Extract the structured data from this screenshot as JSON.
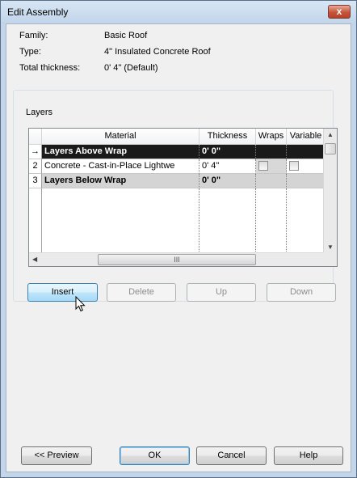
{
  "window": {
    "title": "Edit Assembly",
    "close_glyph": "x"
  },
  "properties": [
    {
      "label": "Family:",
      "value": "Basic Roof"
    },
    {
      "label": "Type:",
      "value": "4\" Insulated Concrete Roof"
    },
    {
      "label": "Total thickness:",
      "value": "0'  4\" (Default)"
    }
  ],
  "layers": {
    "group_title": "Layers",
    "columns": [
      "Material",
      "Thickness",
      "Wraps",
      "Variable"
    ],
    "rows": [
      {
        "num": "→",
        "material": "Layers Above Wrap",
        "thickness": "0'  0\"",
        "wraps": null,
        "variable": null,
        "style": "dark"
      },
      {
        "num": "2",
        "material": "Concrete - Cast-in-Place Lightwe",
        "thickness": "0'  4\"",
        "wraps": false,
        "variable": false,
        "style": "normal"
      },
      {
        "num": "3",
        "material": "Layers Below Wrap",
        "thickness": "0'  0\"",
        "wraps": null,
        "variable": null,
        "style": "gray"
      }
    ],
    "scroll_grip": "III"
  },
  "layer_buttons": {
    "insert": "Insert",
    "delete": "Delete",
    "up": "Up",
    "down": "Down"
  },
  "footer_buttons": {
    "preview": "<< Preview",
    "ok": "OK",
    "cancel": "Cancel",
    "help": "Help"
  }
}
